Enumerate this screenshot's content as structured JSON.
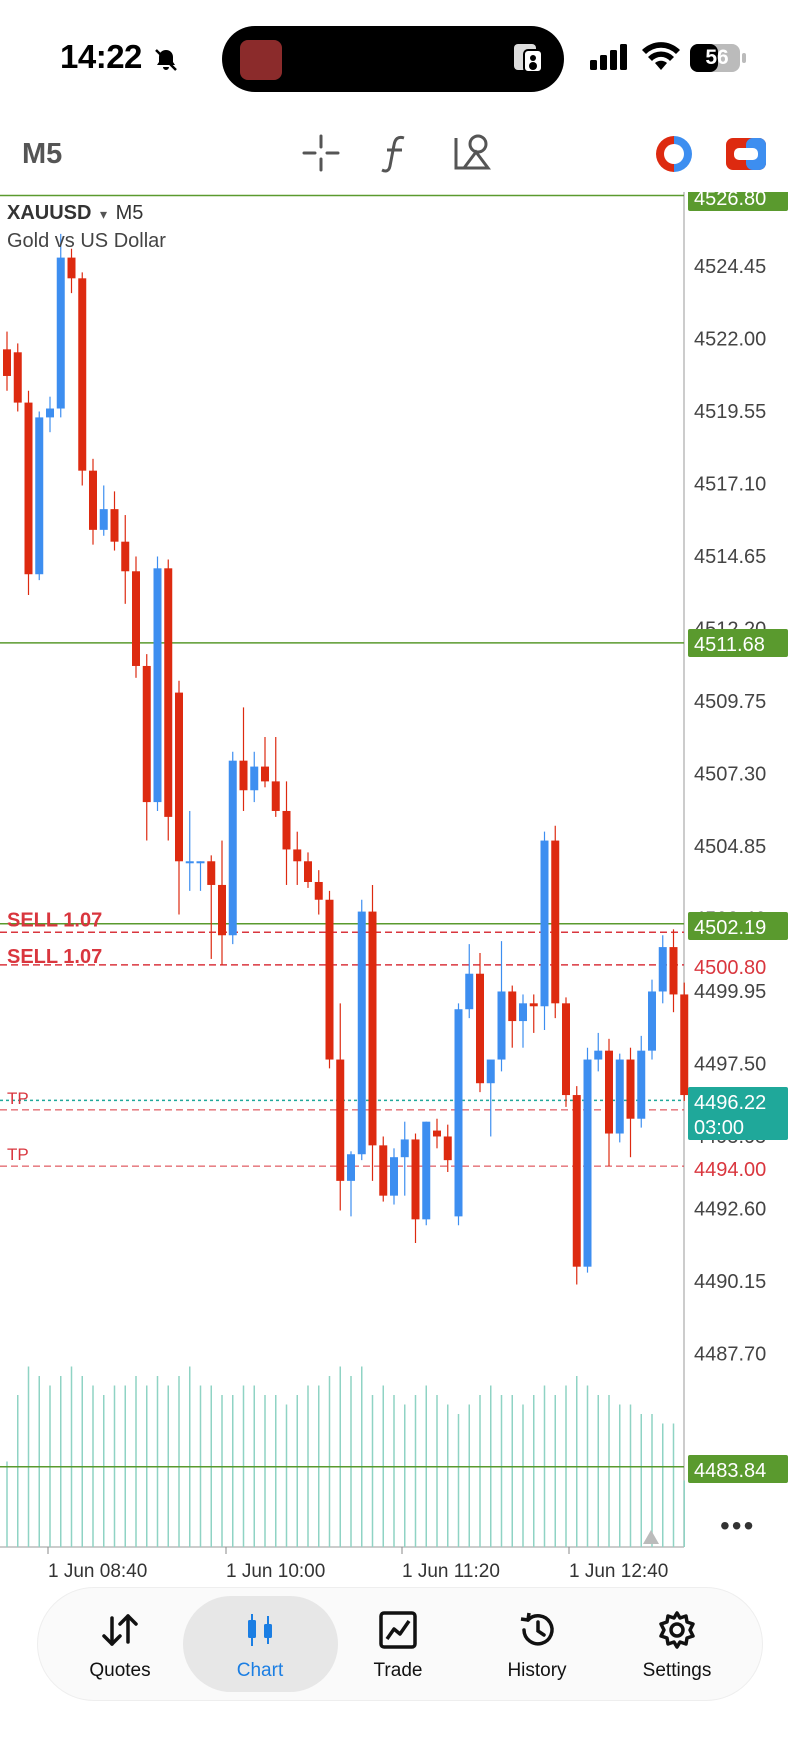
{
  "status": {
    "time": "14:22",
    "battery": "56"
  },
  "toolbar": {
    "timeframe": "M5"
  },
  "symbol": {
    "name": "XAUUSD",
    "dropdown_glyph": "▾",
    "timeframe": "M5",
    "description": "Gold vs US Dollar"
  },
  "price_axis": {
    "ticks": [
      "4524.45",
      "4522.00",
      "4519.55",
      "4517.10",
      "4514.65",
      "4512.20",
      "4509.75",
      "4507.30",
      "4504.85",
      "4502.40",
      "4499.95",
      "4497.50",
      "4495.05",
      "4492.60",
      "4490.15",
      "4487.70"
    ],
    "badges": [
      {
        "label": "4526.80",
        "color": "#5a9a2e"
      },
      {
        "label": "4511.68",
        "color": "#5a9a2e"
      },
      {
        "label": "4502.19",
        "color": "#5a9a2e"
      },
      {
        "label": "4500.80",
        "color": "#ffffff"
      },
      {
        "label": "4496.22",
        "color": "#1fa89a"
      },
      {
        "label": "03:00",
        "color": "#1fa89a"
      },
      {
        "label": "4494.00",
        "color": "#ffffff"
      },
      {
        "label": "4483.84",
        "color": "#5a9a2e"
      }
    ]
  },
  "time_axis": {
    "labels": [
      "1 Jun 08:40",
      "1 Jun 10:00",
      "1 Jun 11:20",
      "1 Jun 12:40"
    ]
  },
  "order_labels": {
    "sell_1": "SELL 1.07",
    "sell_2": "SELL 1.07",
    "tp_1": "TP",
    "tp_2": "TP"
  },
  "colors": {
    "bull": "#3d8ef0",
    "bear": "#dd2a10",
    "volume": "#8fd3c4",
    "hline": "#5a9a2e",
    "order": "#d9363e",
    "bid": "#1fa89a"
  },
  "chart_data": {
    "type": "candlestick",
    "symbol": "XAUUSD",
    "timeframe": "M5",
    "title": "Gold vs US Dollar",
    "ylim": [
      4484.5,
      4527.0
    ],
    "candles": [
      {
        "o": 4521.6,
        "h": 4522.2,
        "l": 4520.2,
        "c": 4520.7
      },
      {
        "o": 4521.5,
        "h": 4521.8,
        "l": 4519.5,
        "c": 4519.8
      },
      {
        "o": 4519.8,
        "h": 4520.2,
        "l": 4513.3,
        "c": 4514.0
      },
      {
        "o": 4514.0,
        "h": 4519.5,
        "l": 4513.8,
        "c": 4519.3
      },
      {
        "o": 4519.3,
        "h": 4520.0,
        "l": 4518.8,
        "c": 4519.6
      },
      {
        "o": 4519.6,
        "h": 4525.5,
        "l": 4519.3,
        "c": 4524.7
      },
      {
        "o": 4524.7,
        "h": 4525.0,
        "l": 4523.5,
        "c": 4524.0
      },
      {
        "o": 4524.0,
        "h": 4524.2,
        "l": 4517.0,
        "c": 4517.5
      },
      {
        "o": 4517.5,
        "h": 4517.9,
        "l": 4515.0,
        "c": 4515.5
      },
      {
        "o": 4515.5,
        "h": 4517.0,
        "l": 4515.3,
        "c": 4516.2
      },
      {
        "o": 4516.2,
        "h": 4516.8,
        "l": 4514.8,
        "c": 4515.1
      },
      {
        "o": 4515.1,
        "h": 4516.0,
        "l": 4513.0,
        "c": 4514.1
      },
      {
        "o": 4514.1,
        "h": 4514.6,
        "l": 4510.5,
        "c": 4510.9
      },
      {
        "o": 4510.9,
        "h": 4511.3,
        "l": 4505.0,
        "c": 4506.3
      },
      {
        "o": 4506.3,
        "h": 4514.6,
        "l": 4506.0,
        "c": 4514.2
      },
      {
        "o": 4514.2,
        "h": 4514.5,
        "l": 4505.0,
        "c": 4505.8
      },
      {
        "o": 4510.0,
        "h": 4510.4,
        "l": 4502.5,
        "c": 4504.3
      },
      {
        "o": 4504.3,
        "h": 4506.0,
        "l": 4503.3,
        "c": 4504.3
      },
      {
        "o": 4504.3,
        "h": 4504.3,
        "l": 4503.3,
        "c": 4504.3
      },
      {
        "o": 4504.3,
        "h": 4504.5,
        "l": 4501.0,
        "c": 4503.5
      },
      {
        "o": 4503.5,
        "h": 4505.0,
        "l": 4500.8,
        "c": 4501.8
      },
      {
        "o": 4501.8,
        "h": 4508.0,
        "l": 4501.5,
        "c": 4507.7
      },
      {
        "o": 4507.7,
        "h": 4509.5,
        "l": 4506.0,
        "c": 4506.7
      },
      {
        "o": 4506.7,
        "h": 4508.0,
        "l": 4506.3,
        "c": 4507.5
      },
      {
        "o": 4507.5,
        "h": 4508.5,
        "l": 4506.8,
        "c": 4507.0
      },
      {
        "o": 4507.0,
        "h": 4508.5,
        "l": 4505.8,
        "c": 4506.0
      },
      {
        "o": 4506.0,
        "h": 4507.0,
        "l": 4503.5,
        "c": 4504.7
      },
      {
        "o": 4504.7,
        "h": 4505.3,
        "l": 4503.5,
        "c": 4504.3
      },
      {
        "o": 4504.3,
        "h": 4504.6,
        "l": 4503.4,
        "c": 4503.6
      },
      {
        "o": 4503.6,
        "h": 4504.0,
        "l": 4502.5,
        "c": 4503.0
      },
      {
        "o": 4503.0,
        "h": 4503.3,
        "l": 4497.3,
        "c": 4497.6
      },
      {
        "o": 4497.6,
        "h": 4499.5,
        "l": 4492.5,
        "c": 4493.5
      },
      {
        "o": 4493.5,
        "h": 4494.5,
        "l": 4492.3,
        "c": 4494.4
      },
      {
        "o": 4494.4,
        "h": 4503.0,
        "l": 4494.2,
        "c": 4502.6
      },
      {
        "o": 4502.6,
        "h": 4503.5,
        "l": 4493.5,
        "c": 4494.7
      },
      {
        "o": 4494.7,
        "h": 4495.0,
        "l": 4492.8,
        "c": 4493.0
      },
      {
        "o": 4493.0,
        "h": 4494.6,
        "l": 4492.7,
        "c": 4494.3
      },
      {
        "o": 4494.3,
        "h": 4495.5,
        "l": 4493.0,
        "c": 4494.9
      },
      {
        "o": 4494.9,
        "h": 4495.1,
        "l": 4491.4,
        "c": 4492.2
      },
      {
        "o": 4492.2,
        "h": 4495.5,
        "l": 4492.0,
        "c": 4495.5
      },
      {
        "o": 4495.2,
        "h": 4495.6,
        "l": 4494.6,
        "c": 4495.0
      },
      {
        "o": 4495.0,
        "h": 4495.4,
        "l": 4493.8,
        "c": 4494.2
      },
      {
        "o": 4492.3,
        "h": 4499.5,
        "l": 4492.0,
        "c": 4499.3
      },
      {
        "o": 4499.3,
        "h": 4501.5,
        "l": 4499.0,
        "c": 4500.5
      },
      {
        "o": 4500.5,
        "h": 4501.2,
        "l": 4496.5,
        "c": 4496.8
      },
      {
        "o": 4496.8,
        "h": 4497.5,
        "l": 4495.0,
        "c": 4497.6
      },
      {
        "o": 4497.6,
        "h": 4501.6,
        "l": 4497.2,
        "c": 4499.9
      },
      {
        "o": 4499.9,
        "h": 4500.1,
        "l": 4498.0,
        "c": 4498.9
      },
      {
        "o": 4498.9,
        "h": 4499.8,
        "l": 4498.0,
        "c": 4499.5
      },
      {
        "o": 4499.5,
        "h": 4499.8,
        "l": 4498.5,
        "c": 4499.4
      },
      {
        "o": 4499.4,
        "h": 4505.3,
        "l": 4498.6,
        "c": 4505.0
      },
      {
        "o": 4505.0,
        "h": 4505.5,
        "l": 4499.0,
        "c": 4499.5
      },
      {
        "o": 4499.5,
        "h": 4499.7,
        "l": 4496.0,
        "c": 4496.4
      },
      {
        "o": 4496.4,
        "h": 4496.7,
        "l": 4490.0,
        "c": 4490.6
      },
      {
        "o": 4490.6,
        "h": 4498.0,
        "l": 4490.4,
        "c": 4497.6
      },
      {
        "o": 4497.6,
        "h": 4498.5,
        "l": 4497.2,
        "c": 4497.9
      },
      {
        "o": 4497.9,
        "h": 4498.3,
        "l": 4494.0,
        "c": 4495.1
      },
      {
        "o": 4495.1,
        "h": 4497.8,
        "l": 4494.8,
        "c": 4497.6
      },
      {
        "o": 4497.6,
        "h": 4498.0,
        "l": 4494.3,
        "c": 4495.6
      },
      {
        "o": 4495.6,
        "h": 4498.4,
        "l": 4495.3,
        "c": 4497.9
      },
      {
        "o": 4497.9,
        "h": 4500.3,
        "l": 4497.6,
        "c": 4499.9
      },
      {
        "o": 4499.9,
        "h": 4501.8,
        "l": 4499.5,
        "c": 4501.4
      },
      {
        "o": 4501.4,
        "h": 4502.0,
        "l": 4499.2,
        "c": 4499.8
      },
      {
        "o": 4499.8,
        "h": 4500.2,
        "l": 4496.2,
        "c": 4496.4
      }
    ],
    "volume_relative": [
      0.45,
      0.8,
      0.95,
      0.9,
      0.85,
      0.9,
      0.95,
      0.9,
      0.85,
      0.8,
      0.85,
      0.85,
      0.9,
      0.85,
      0.9,
      0.85,
      0.9,
      0.95,
      0.85,
      0.85,
      0.8,
      0.8,
      0.85,
      0.85,
      0.8,
      0.8,
      0.75,
      0.8,
      0.85,
      0.85,
      0.9,
      0.95,
      0.9,
      0.95,
      0.8,
      0.85,
      0.8,
      0.75,
      0.8,
      0.85,
      0.8,
      0.75,
      0.7,
      0.75,
      0.8,
      0.85,
      0.8,
      0.8,
      0.75,
      0.8,
      0.85,
      0.8,
      0.85,
      0.9,
      0.85,
      0.8,
      0.8,
      0.75,
      0.75,
      0.7,
      0.7,
      0.65,
      0.65,
      0.35
    ],
    "horizontal_lines": [
      {
        "price": 4526.8,
        "kind": "level"
      },
      {
        "price": 4511.68,
        "kind": "level"
      },
      {
        "price": 4502.19,
        "kind": "level"
      },
      {
        "price": 4483.84,
        "kind": "level"
      },
      {
        "price": 4501.9,
        "kind": "order",
        "label": "SELL 1.07"
      },
      {
        "price": 4500.8,
        "kind": "order",
        "label": "SELL 1.07"
      },
      {
        "price": 4496.22,
        "kind": "bid"
      },
      {
        "price": 4495.9,
        "kind": "tp",
        "label": "TP"
      },
      {
        "price": 4494.0,
        "kind": "tp",
        "label": "TP"
      }
    ]
  },
  "nav": {
    "items": [
      {
        "label": "Quotes",
        "active": false
      },
      {
        "label": "Chart",
        "active": true
      },
      {
        "label": "Trade",
        "active": false
      },
      {
        "label": "History",
        "active": false
      },
      {
        "label": "Settings",
        "active": false
      }
    ]
  },
  "icons": [
    "bell-off-icon",
    "screen-mirror-icon",
    "signal-icon",
    "wifi-icon",
    "battery-icon",
    "crosshair-icon",
    "function-icon",
    "objects-icon",
    "one-click-trading-icon",
    "account-icon",
    "dropdown-icon",
    "more-icon",
    "quotes-icon",
    "chart-icon",
    "trade-icon",
    "history-icon",
    "settings-icon"
  ]
}
